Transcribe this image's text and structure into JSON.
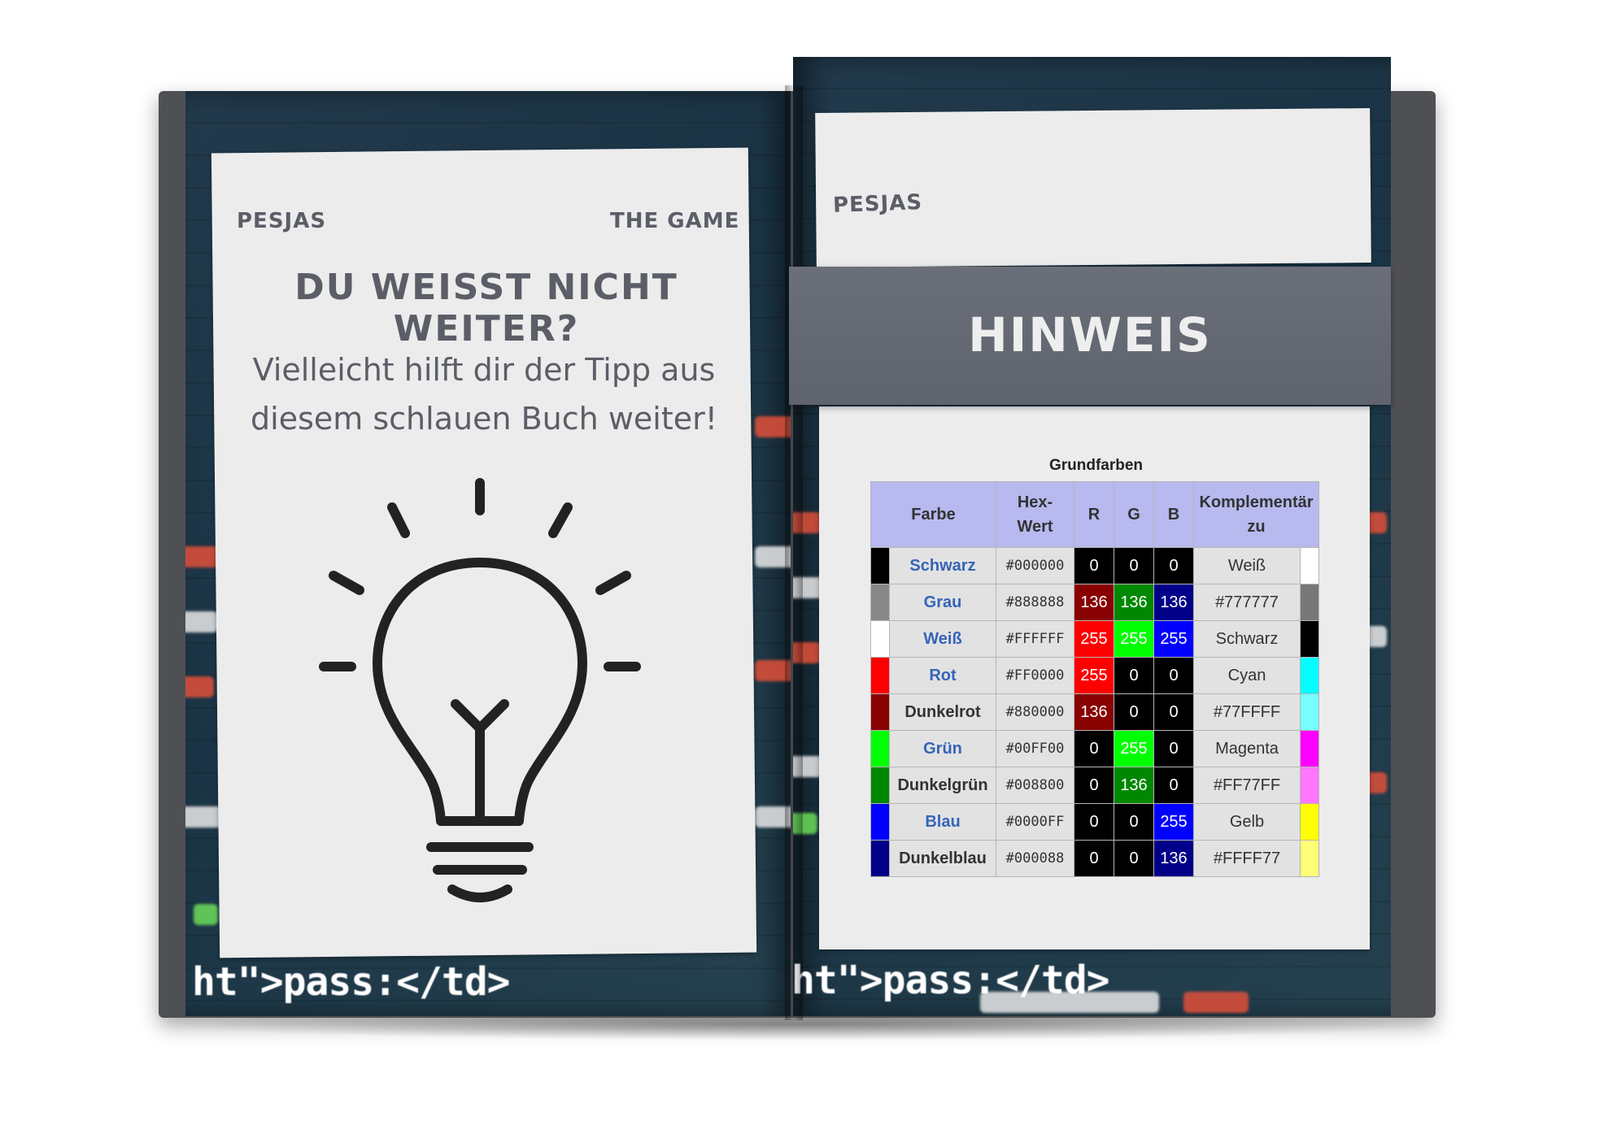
{
  "left_page": {
    "brand": "PESJAS",
    "game_label": "THE GAME",
    "headline": "DU WEISST NICHT WEITER?",
    "subtext_line1": "Vielleicht hilft dir der Tipp aus",
    "subtext_line2": "diesem schlauen Buch weiter!",
    "illustration": "lightbulb-icon"
  },
  "right_page": {
    "brand": "PESJAS",
    "band_title": "HINWEIS"
  },
  "background_code": {
    "left_bottom": "ht\">pass:</td>",
    "right_bottom": "ht\">pass:</td>"
  },
  "color_table": {
    "caption": "Grundfarben",
    "headers": {
      "farbe": "Farbe",
      "hex_line1": "Hex-",
      "hex_line2": "Wert",
      "r": "R",
      "g": "G",
      "b": "B",
      "comp_line1": "Komplementär",
      "comp_line2": "zu"
    },
    "rows": [
      {
        "name": "Schwarz",
        "hex": "#000000",
        "r": "0",
        "g": "0",
        "b": "0",
        "comp": "Weiß",
        "color": "#000000",
        "comp_color": "#ffffff",
        "link": true
      },
      {
        "name": "Grau",
        "hex": "#888888",
        "r": "136",
        "g": "136",
        "b": "136",
        "comp": "#777777",
        "color": "#888888",
        "comp_color": "#777777",
        "link": true
      },
      {
        "name": "Weiß",
        "hex": "#FFFFFF",
        "r": "255",
        "g": "255",
        "b": "255",
        "comp": "Schwarz",
        "color": "#ffffff",
        "comp_color": "#000000",
        "link": true
      },
      {
        "name": "Rot",
        "hex": "#FF0000",
        "r": "255",
        "g": "0",
        "b": "0",
        "comp": "Cyan",
        "color": "#ff0000",
        "comp_color": "#00ffff",
        "link": true
      },
      {
        "name": "Dunkelrot",
        "hex": "#880000",
        "r": "136",
        "g": "0",
        "b": "0",
        "comp": "#77FFFF",
        "color": "#880000",
        "comp_color": "#77ffff",
        "link": false
      },
      {
        "name": "Grün",
        "hex": "#00FF00",
        "r": "0",
        "g": "255",
        "b": "0",
        "comp": "Magenta",
        "color": "#00ff00",
        "comp_color": "#ff00ff",
        "link": true
      },
      {
        "name": "Dunkelgrün",
        "hex": "#008800",
        "r": "0",
        "g": "136",
        "b": "0",
        "comp": "#FF77FF",
        "color": "#008800",
        "comp_color": "#ff77ff",
        "link": false
      },
      {
        "name": "Blau",
        "hex": "#0000FF",
        "r": "0",
        "g": "0",
        "b": "255",
        "comp": "Gelb",
        "color": "#0000ff",
        "comp_color": "#ffff00",
        "link": true
      },
      {
        "name": "Dunkelblau",
        "hex": "#000088",
        "r": "0",
        "g": "0",
        "b": "136",
        "comp": "#FFFF77",
        "color": "#000088",
        "comp_color": "#ffff77",
        "link": false
      }
    ]
  }
}
